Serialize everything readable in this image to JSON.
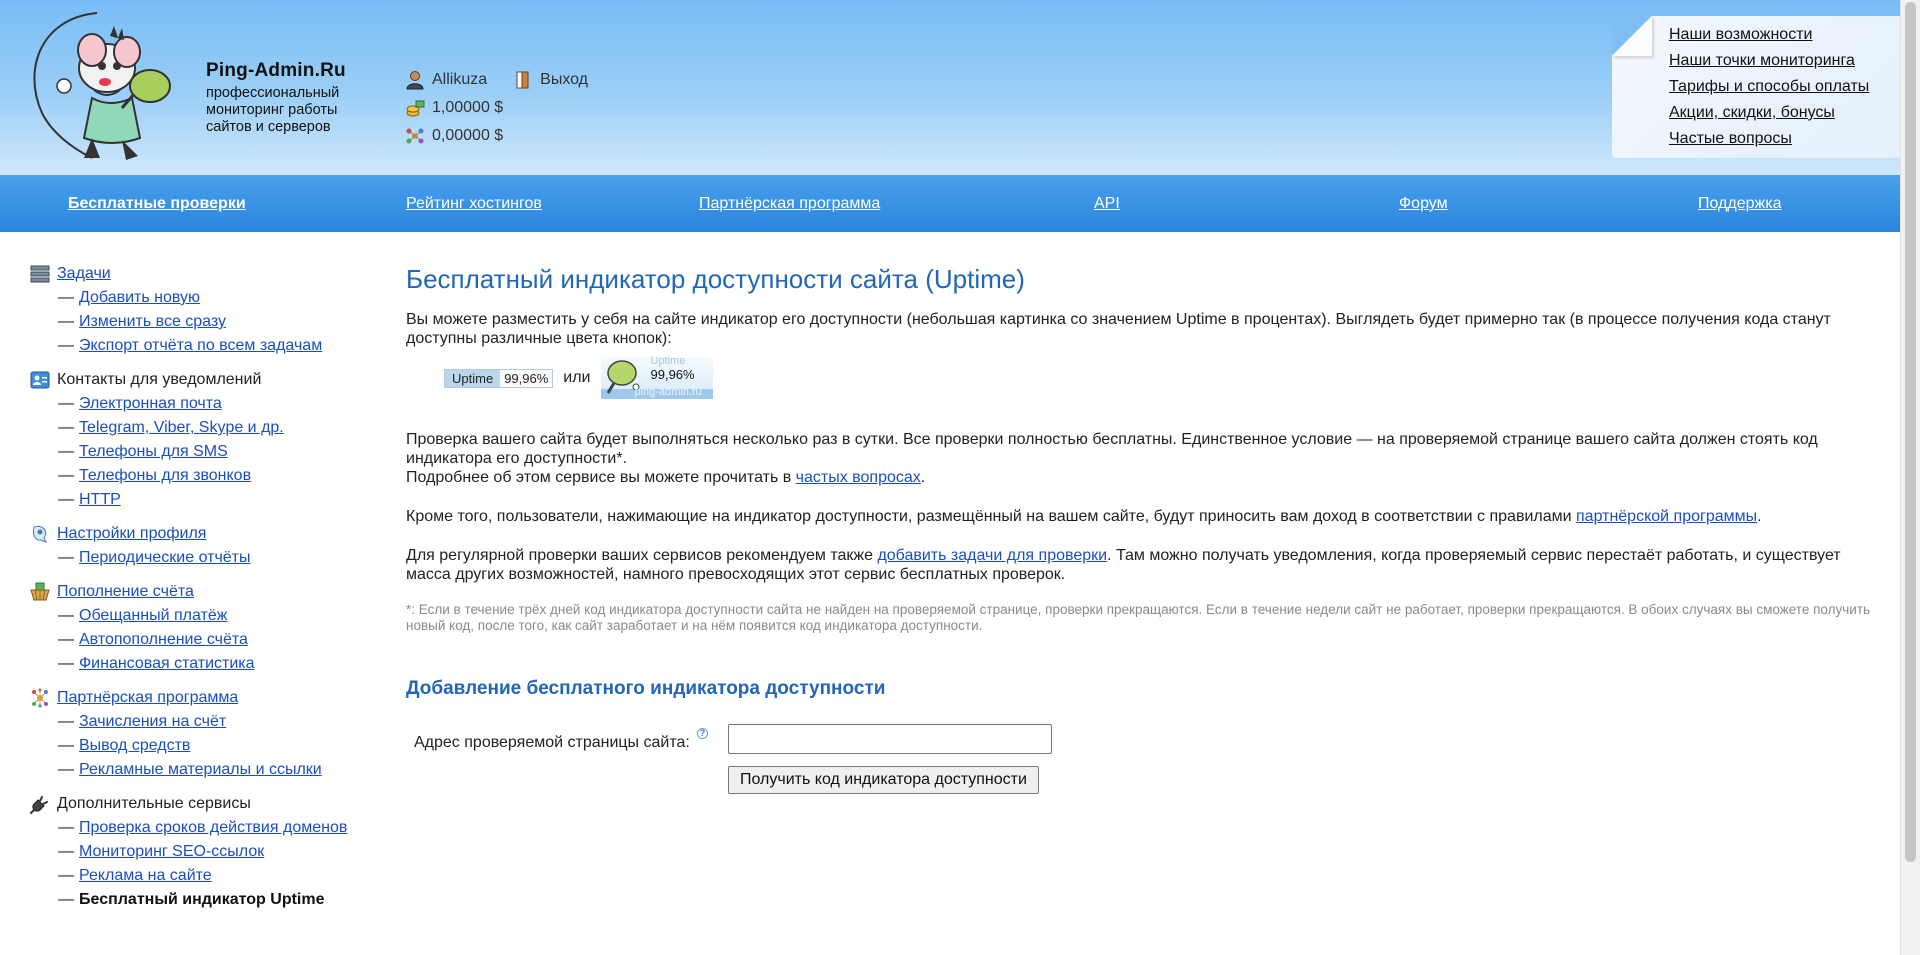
{
  "brand": {
    "name": "Ping-Admin.Ru",
    "tagline_1": "профессиональный",
    "tagline_2": "мониторинг работы",
    "tagline_3": "сайтов и серверов"
  },
  "account": {
    "username": "Allikuza",
    "logout_label": "Выход",
    "balance_main": "1,00000 $",
    "balance_bonus": "0,00000 $"
  },
  "infobox": {
    "links": [
      "Наши возможности",
      "Наши точки мониторинга",
      "Тарифы и способы оплаты",
      "Акции, скидки, бонусы",
      "Частые вопросы"
    ]
  },
  "nav": {
    "items": [
      "Бесплатные проверки",
      "Рейтинг хостингов",
      "Партнёрская программа",
      "API",
      "Форум",
      "Поддержка"
    ]
  },
  "sidebar": {
    "groups": [
      {
        "title": "Задачи",
        "items": [
          "Добавить новую",
          "Изменить все сразу",
          "Экспорт отчёта по всем задачам"
        ]
      },
      {
        "title": "Контакты для уведомлений",
        "items": [
          "Электронная почта",
          "Telegram, Viber, Skype и др.",
          "Телефоны для SMS",
          "Телефоны для звонков",
          "HTTP"
        ]
      },
      {
        "title": "Настройки профиля",
        "items": [
          "Периодические отчёты"
        ]
      },
      {
        "title": "Пополнение счёта",
        "items": [
          "Обещанный платёж",
          "Автопополнение счёта",
          "Финансовая статистика"
        ]
      },
      {
        "title": "Партнёрская программа",
        "items": [
          "Зачисления на счёт",
          "Вывод средств",
          "Рекламные материалы и ссылки"
        ]
      },
      {
        "title": "Дополнительные сервисы",
        "items": [
          "Проверка сроков действия доменов",
          "Мониторинг SEO-ссылок",
          "Реклама на сайте",
          "Бесплатный индикатор Uptime"
        ]
      }
    ],
    "dash": "—"
  },
  "main": {
    "title": "Бесплатный индикатор доступности сайта (Uptime)",
    "intro": "Вы можете разместить у себя на сайте индикатор его доступности (небольшая картинка со значением Uptime в процентах). Выглядеть будет примерно так (в процессе получения кода станут доступны различные цвета кнопок):",
    "sample": {
      "badge1_label": "Uptime",
      "badge1_value": "99,96%",
      "or": "или",
      "badge2_label": "Uptime",
      "badge2_value": "99,96%",
      "badge2_site": "ping-admin.ru"
    },
    "p2_a": "Проверка вашего сайта будет выполняться несколько раз в сутки. Все проверки полностью бесплатны. Единственное условие — на проверяемой странице вашего сайта должен стоять код индикатора его доступности*.",
    "p2_b_prefix": "Подробнее об этом сервисе вы можете прочитать в ",
    "p2_b_link": "частых вопросах",
    "p2_b_suffix": ".",
    "p3_prefix": "Кроме того, пользователи, нажимающие на индикатор доступности, размещённый на вашем сайте, будут приносить вам доход в соответствии с правилами ",
    "p3_link": "партнёрской программы",
    "p3_suffix": ".",
    "p4_prefix": "Для регулярной проверки ваших сервисов рекомендуем также ",
    "p4_link": "добавить задачи для проверки",
    "p4_suffix": ". Там можно получать уведомления, когда проверяемый сервис перестаёт работать, и существует масса других возможностей, намного превосходящих этот сервис бесплатных проверок.",
    "footnote": "*: Если в течение трёх дней код индикатора доступности сайта не найден на проверяемой странице, проверки прекращаются. Если в течение недели сайт не работает, проверки прекращаются. В обоих случаях вы сможете получить новый код, после того, как сайт заработает и на нём появится код индикатора доступности.",
    "form_title": "Добавление бесплатного индикатора доступности",
    "form": {
      "url_label": "Адрес проверяемой страницы сайта:",
      "help_mark": "?",
      "url_value": "",
      "submit_label": "Получить код индикатора доступности"
    }
  },
  "colors": {
    "accent": "#2266b8",
    "nav_bg": "#2b85dc",
    "link": "#1a4ec0"
  }
}
